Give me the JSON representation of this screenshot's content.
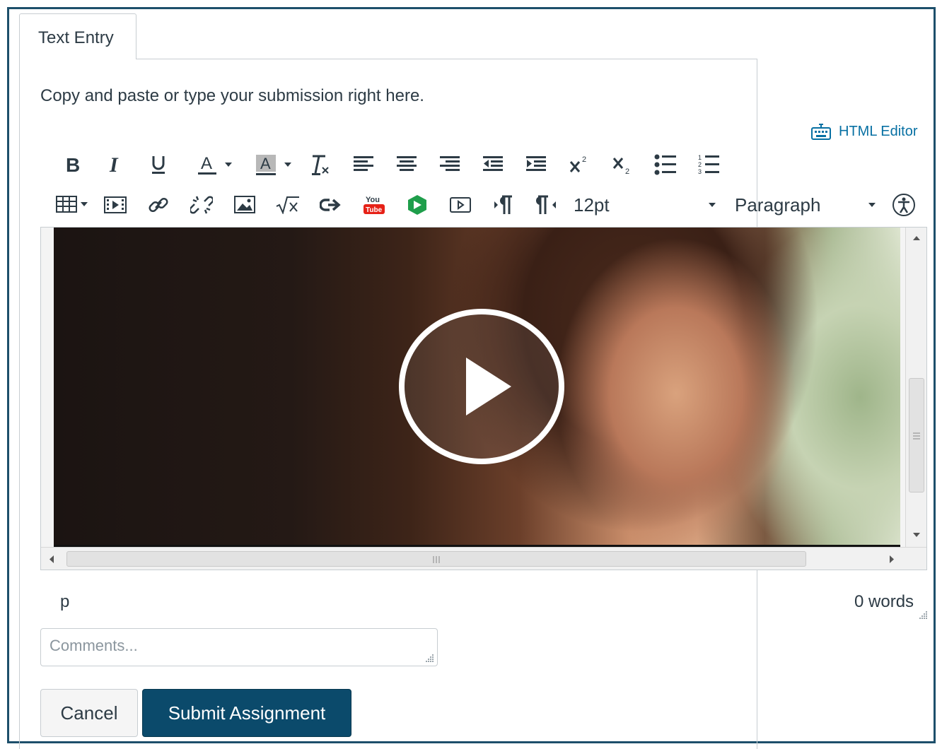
{
  "tab": {
    "label": "Text Entry"
  },
  "instructions": "Copy and paste or type your submission right here.",
  "html_editor": {
    "label": "HTML Editor",
    "icon": "keyboard-icon"
  },
  "toolbar": {
    "row1": [
      "bold",
      "italic",
      "underline",
      "text-color",
      "text-color-dropdown",
      "background-color",
      "background-color-dropdown",
      "clear-formatting",
      "align-left",
      "align-center",
      "align-right",
      "outdent",
      "indent",
      "superscript",
      "subscript",
      "bullet-list",
      "numbered-list"
    ],
    "row2": [
      "table",
      "media",
      "link",
      "unlink",
      "image",
      "math-equation",
      "embed",
      "youtube",
      "google-drive-app",
      "record-media",
      "ltr-direction",
      "rtl-direction"
    ],
    "font_size": "12pt",
    "block_format": "Paragraph",
    "accessibility_icon": "accessibility-checker-icon"
  },
  "editor": {
    "media": "video-thumbnail",
    "play_icon": "play-icon",
    "status_path": "p",
    "word_count": "0 words"
  },
  "comments": {
    "placeholder": "Comments..."
  },
  "actions": {
    "cancel": "Cancel",
    "submit": "Submit Assignment"
  },
  "colors": {
    "link": "#0770a3",
    "primary": "#0b4a6b",
    "frame": "#1d4f6b",
    "text": "#2d3b45"
  }
}
